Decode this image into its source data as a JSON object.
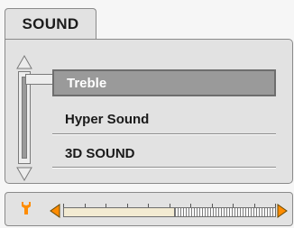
{
  "header": {
    "tab_title": "SOUND"
  },
  "menu": {
    "items": [
      {
        "label": "Treble",
        "selected": true
      },
      {
        "label": "Hyper Sound",
        "selected": false
      },
      {
        "label": "3D SOUND",
        "selected": false
      }
    ]
  },
  "slider": {
    "icon": "wrench-icon",
    "level_fraction": 0.52,
    "tick_count": 10
  },
  "colors": {
    "selected_bg": "#9a9a9a",
    "selected_text": "#ffffff",
    "slider_arrow": "#ff8c00",
    "wrench": "#ff8c00",
    "slider_fill": "#f3ebd2"
  }
}
